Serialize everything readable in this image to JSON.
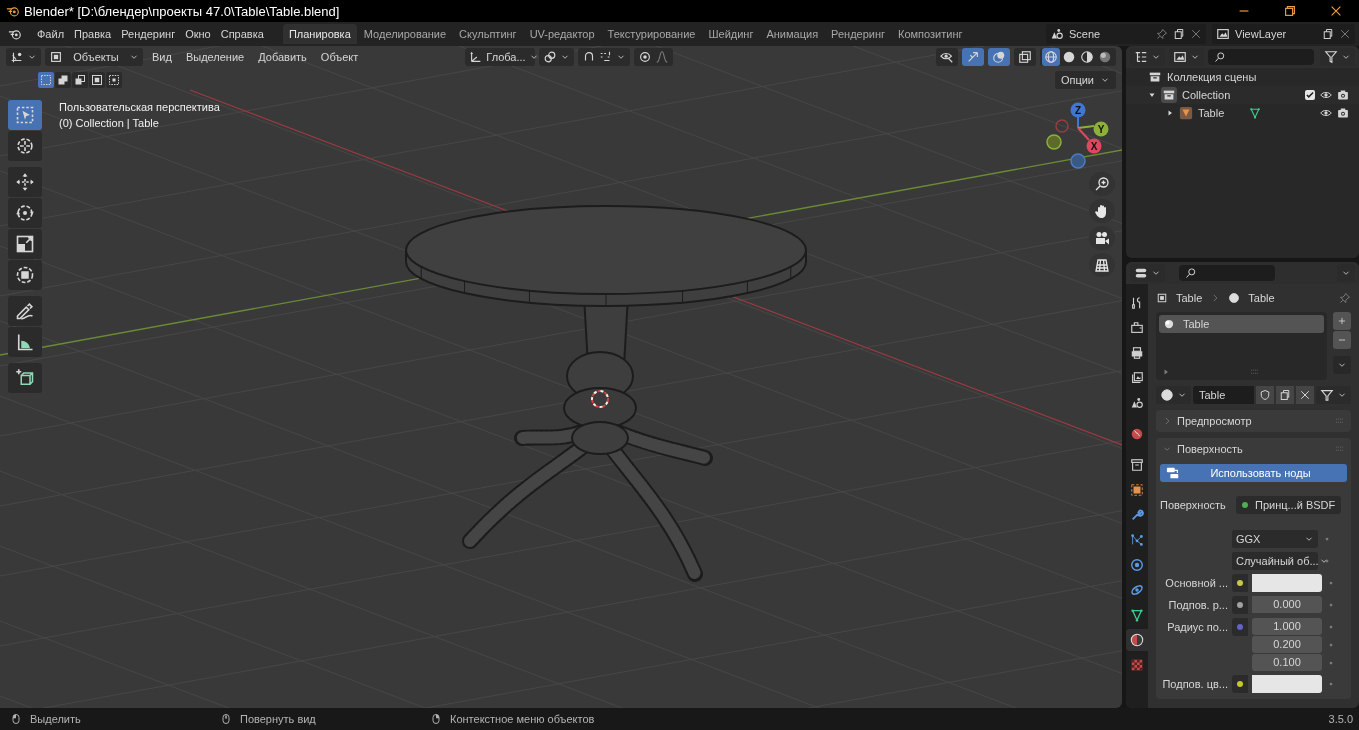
{
  "window": {
    "title": "Blender* [D:\\блендер\\проекты 47.0\\Table\\Table.blend]"
  },
  "menu": [
    "Файл",
    "Правка",
    "Рендеринг",
    "Окно",
    "Справка"
  ],
  "workspaces": [
    {
      "label": "Планировка",
      "selected": true
    },
    {
      "label": "Моделирование",
      "selected": false
    },
    {
      "label": "Скульптинг",
      "selected": false
    },
    {
      "label": "UV-редактор",
      "selected": false
    },
    {
      "label": "Текстурирование",
      "selected": false
    },
    {
      "label": "Шейдинг",
      "selected": false
    },
    {
      "label": "Анимация",
      "selected": false
    },
    {
      "label": "Рендеринг",
      "selected": false
    },
    {
      "label": "Композитинг",
      "selected": false
    }
  ],
  "scene": "Scene",
  "view_layer": "ViewLayer",
  "viewport": {
    "mode": "Объекты",
    "menus": [
      "Вид",
      "Выделение",
      "Добавить",
      "Объект"
    ],
    "orientation": "Глоба...",
    "options": "Опции",
    "view_name": "Пользовательская перспектива",
    "context": "(0) Collection | Table",
    "select_modes": [
      {
        "selected": true
      },
      {
        "selected": false
      },
      {
        "selected": false
      },
      {
        "selected": false
      },
      {
        "selected": false
      }
    ],
    "toggles": [
      {
        "kind": "visibility",
        "on": false
      },
      {
        "kind": "gizmo",
        "on": true
      },
      {
        "kind": "overlay",
        "on": true
      },
      {
        "kind": "xray",
        "on": false
      }
    ],
    "shading": [
      {
        "kind": "wireframe",
        "selected": true
      },
      {
        "kind": "solid",
        "selected": false
      },
      {
        "kind": "material",
        "selected": false
      },
      {
        "kind": "rendered",
        "selected": false
      }
    ],
    "tools": [
      {
        "kind": "select",
        "selected": true
      },
      {
        "kind": "cursor",
        "selected": false
      },
      {
        "kind": "move",
        "selected": false
      },
      {
        "kind": "rotate",
        "selected": false
      },
      {
        "kind": "scale",
        "selected": false
      },
      {
        "kind": "transform",
        "selected": false
      },
      {
        "kind": "annotate",
        "selected": false
      },
      {
        "kind": "measure",
        "selected": false
      },
      {
        "kind": "add_cube",
        "selected": false
      }
    ],
    "axes": [
      "Z",
      "Y",
      "X"
    ]
  },
  "outliner": {
    "title": "Коллекция сцены",
    "items": [
      {
        "label": "Collection",
        "expanded": true,
        "checked": true,
        "children": [
          {
            "label": "Table",
            "expanded": false
          }
        ]
      }
    ]
  },
  "properties": {
    "tabs": [
      {
        "kind": "tool",
        "selected": false
      },
      {
        "kind": "render",
        "selected": false
      },
      {
        "kind": "output",
        "selected": false
      },
      {
        "kind": "view_layer",
        "selected": false
      },
      {
        "kind": "scene",
        "selected": false
      },
      {
        "kind": "world",
        "selected": false
      },
      {
        "kind": "collection",
        "selected": false
      },
      {
        "kind": "object",
        "selected": false
      },
      {
        "kind": "modifiers",
        "selected": false
      },
      {
        "kind": "particles",
        "selected": false
      },
      {
        "kind": "physics",
        "selected": false
      },
      {
        "kind": "constraints",
        "selected": false
      },
      {
        "kind": "data",
        "selected": false
      },
      {
        "kind": "material",
        "selected": true
      },
      {
        "kind": "texture",
        "selected": false
      }
    ],
    "breadcrumb": [
      "Table",
      "Table"
    ],
    "slots": [
      {
        "label": "Table",
        "selected": true
      }
    ],
    "material": "Table",
    "panels": [
      {
        "label": "Предпросмотр",
        "expanded": false
      },
      {
        "label": "Поверхность",
        "expanded": true
      }
    ],
    "use_nodes": "Использовать ноды",
    "fields": [
      {
        "kind": "link",
        "label": "Поверхность",
        "value": "Принц...й BSDF",
        "color": "#4caf50"
      },
      {
        "kind": "dropdown",
        "value": "GGX"
      },
      {
        "kind": "dropdown",
        "value": "Случайный об..."
      },
      {
        "kind": "color",
        "label": "Основной ...",
        "color": "#c7c74a"
      },
      {
        "kind": "number",
        "label": "Подпов. р...",
        "values": [
          "0.000"
        ],
        "color": "#a1a1a1"
      },
      {
        "kind": "number",
        "label": "Радиус по...",
        "values": [
          "1.000",
          "0.200",
          "0.100"
        ],
        "color": "#6363c7"
      },
      {
        "kind": "color",
        "label": "Подпов. цв...",
        "color": "#c7c729"
      }
    ]
  },
  "status_bar": {
    "hints": [
      "Выделить",
      "Повернуть вид",
      "Контекстное меню объектов"
    ],
    "version": "3.5.0"
  }
}
